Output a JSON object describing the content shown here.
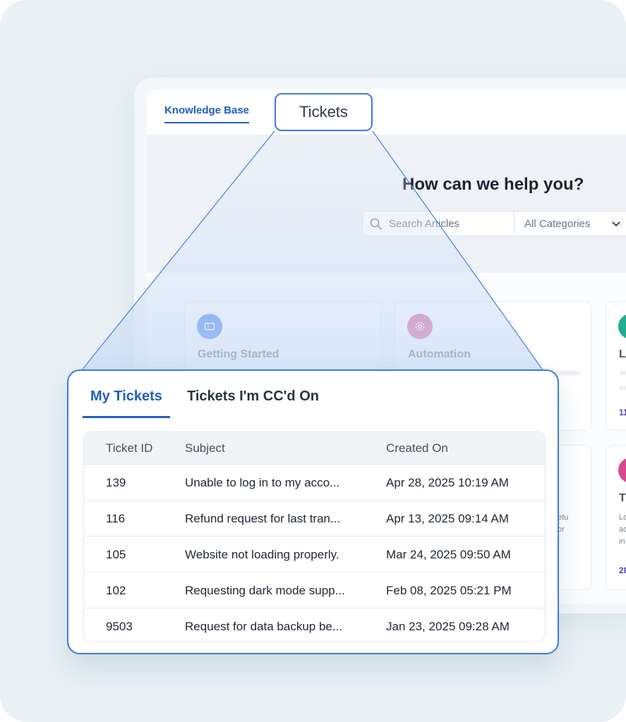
{
  "app": {
    "nav": {
      "knowledge_base_tab": "Knowledge Base",
      "tickets_tab": "Tickets"
    },
    "hero": {
      "title": "How can we help you?",
      "search_placeholder": "Search Articles",
      "category_select": "All Categories"
    },
    "cards": [
      {
        "title": "Getting Started",
        "icon": "ticket-icon",
        "color": "#3a7bea"
      },
      {
        "title": "Automation",
        "icon": "gear-icon",
        "color": "#e0558f"
      },
      {
        "title": "Li",
        "icon": "partial-icon",
        "color": "#1fae8f",
        "count": "11"
      },
      {
        "title": "T",
        "icon": "partial-icon",
        "color": "#d9498f",
        "count": "28",
        "text_lines": [
          "Lo",
          "ac",
          "in"
        ]
      }
    ],
    "card_snippet_lines": [
      "etu",
      "or"
    ]
  },
  "tickets_panel": {
    "tabs": [
      {
        "label": "My Tickets",
        "active": true
      },
      {
        "label": "Tickets I'm CC'd On",
        "active": false
      }
    ],
    "columns": [
      "Ticket ID",
      "Subject",
      "Created On"
    ],
    "rows": [
      {
        "id": "139",
        "subject": "Unable to log in to my acco...",
        "created": "Apr 28, 2025 10:19 AM"
      },
      {
        "id": "116",
        "subject": "Refund request for last tran...",
        "created": "Apr 13, 2025 09:14 AM"
      },
      {
        "id": "105",
        "subject": "Website not loading properly.",
        "created": "Mar 24, 2025 09:50 AM"
      },
      {
        "id": "102",
        "subject": "Requesting dark mode supp...",
        "created": "Feb 08, 2025 05:21 PM"
      },
      {
        "id": "9503",
        "subject": "Request for data backup be...",
        "created": "Jan 23, 2025 09:28 AM"
      }
    ]
  },
  "colors": {
    "accent": "#1f5fbf",
    "callout_border": "#3d7be0",
    "background": "#e9f1f5"
  }
}
